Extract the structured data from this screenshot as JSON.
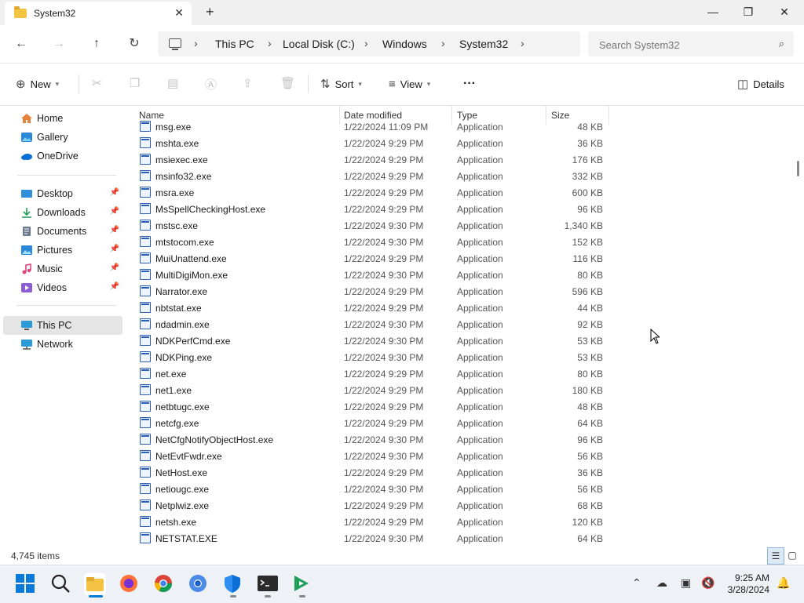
{
  "window": {
    "tab_title": "System32",
    "new_tab": "+",
    "minimize": "—",
    "maximize": "❐",
    "close": "✕"
  },
  "nav": {
    "breadcrumbs": [
      "This PC",
      "Local Disk (C:)",
      "Windows",
      "System32"
    ],
    "search_placeholder": "Search System32"
  },
  "toolbar": {
    "new_label": "New",
    "sort_label": "Sort",
    "view_label": "View",
    "more_label": "···",
    "details_label": "Details"
  },
  "sidebar": {
    "items": [
      {
        "label": "Home",
        "icon": "home-icon"
      },
      {
        "label": "Gallery",
        "icon": "gallery-icon"
      },
      {
        "label": "OneDrive",
        "icon": "onedrive-icon"
      },
      {
        "label": "Desktop",
        "icon": "desktop-icon"
      },
      {
        "label": "Downloads",
        "icon": "downloads-icon"
      },
      {
        "label": "Documents",
        "icon": "documents-icon"
      },
      {
        "label": "Pictures",
        "icon": "pictures-icon"
      },
      {
        "label": "Music",
        "icon": "music-icon"
      },
      {
        "label": "Videos",
        "icon": "videos-icon"
      },
      {
        "label": "This PC",
        "icon": "pc-icon"
      },
      {
        "label": "Network",
        "icon": "network-icon"
      }
    ]
  },
  "columns": {
    "name": "Name",
    "date": "Date modified",
    "type": "Type",
    "size": "Size"
  },
  "files": [
    {
      "name": "msg.exe",
      "date": "1/22/2024 11:09 PM",
      "type": "Application",
      "size": "48 KB"
    },
    {
      "name": "mshta.exe",
      "date": "1/22/2024 9:29 PM",
      "type": "Application",
      "size": "36 KB"
    },
    {
      "name": "msiexec.exe",
      "date": "1/22/2024 9:29 PM",
      "type": "Application",
      "size": "176 KB"
    },
    {
      "name": "msinfo32.exe",
      "date": "1/22/2024 9:29 PM",
      "type": "Application",
      "size": "332 KB"
    },
    {
      "name": "msra.exe",
      "date": "1/22/2024 9:29 PM",
      "type": "Application",
      "size": "600 KB"
    },
    {
      "name": "MsSpellCheckingHost.exe",
      "date": "1/22/2024 9:29 PM",
      "type": "Application",
      "size": "96 KB"
    },
    {
      "name": "mstsc.exe",
      "date": "1/22/2024 9:30 PM",
      "type": "Application",
      "size": "1,340 KB"
    },
    {
      "name": "mtstocom.exe",
      "date": "1/22/2024 9:30 PM",
      "type": "Application",
      "size": "152 KB"
    },
    {
      "name": "MuiUnattend.exe",
      "date": "1/22/2024 9:29 PM",
      "type": "Application",
      "size": "116 KB"
    },
    {
      "name": "MultiDigiMon.exe",
      "date": "1/22/2024 9:30 PM",
      "type": "Application",
      "size": "80 KB"
    },
    {
      "name": "Narrator.exe",
      "date": "1/22/2024 9:29 PM",
      "type": "Application",
      "size": "596 KB"
    },
    {
      "name": "nbtstat.exe",
      "date": "1/22/2024 9:29 PM",
      "type": "Application",
      "size": "44 KB"
    },
    {
      "name": "ndadmin.exe",
      "date": "1/22/2024 9:30 PM",
      "type": "Application",
      "size": "92 KB"
    },
    {
      "name": "NDKPerfCmd.exe",
      "date": "1/22/2024 9:30 PM",
      "type": "Application",
      "size": "53 KB"
    },
    {
      "name": "NDKPing.exe",
      "date": "1/22/2024 9:30 PM",
      "type": "Application",
      "size": "53 KB"
    },
    {
      "name": "net.exe",
      "date": "1/22/2024 9:29 PM",
      "type": "Application",
      "size": "80 KB"
    },
    {
      "name": "net1.exe",
      "date": "1/22/2024 9:29 PM",
      "type": "Application",
      "size": "180 KB"
    },
    {
      "name": "netbtugc.exe",
      "date": "1/22/2024 9:29 PM",
      "type": "Application",
      "size": "48 KB"
    },
    {
      "name": "netcfg.exe",
      "date": "1/22/2024 9:29 PM",
      "type": "Application",
      "size": "64 KB"
    },
    {
      "name": "NetCfgNotifyObjectHost.exe",
      "date": "1/22/2024 9:30 PM",
      "type": "Application",
      "size": "96 KB"
    },
    {
      "name": "NetEvtFwdr.exe",
      "date": "1/22/2024 9:30 PM",
      "type": "Application",
      "size": "56 KB"
    },
    {
      "name": "NetHost.exe",
      "date": "1/22/2024 9:29 PM",
      "type": "Application",
      "size": "36 KB"
    },
    {
      "name": "netiougc.exe",
      "date": "1/22/2024 9:30 PM",
      "type": "Application",
      "size": "56 KB"
    },
    {
      "name": "Netplwiz.exe",
      "date": "1/22/2024 9:29 PM",
      "type": "Application",
      "size": "68 KB"
    },
    {
      "name": "netsh.exe",
      "date": "1/22/2024 9:29 PM",
      "type": "Application",
      "size": "120 KB"
    },
    {
      "name": "NETSTAT.EXE",
      "date": "1/22/2024 9:30 PM",
      "type": "Application",
      "size": "64 KB"
    }
  ],
  "status": {
    "item_count": "4,745 items"
  },
  "taskbar": {
    "time": "9:25 AM",
    "date": "3/28/2024",
    "apps": [
      "start-icon",
      "search-icon",
      "file-explorer-icon",
      "firefox-icon",
      "chrome-icon",
      "chrome-alt-icon",
      "defender-icon",
      "terminal-icon",
      "app-icon"
    ]
  },
  "colors": {
    "accent": "#0067c0",
    "folder": "#f5c343",
    "selected": "#e5e5e5"
  }
}
